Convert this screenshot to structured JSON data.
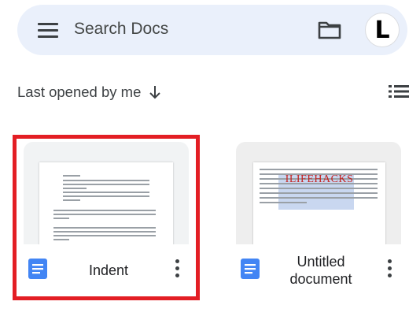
{
  "search": {
    "placeholder": "Search Docs"
  },
  "account": {
    "initial": "L"
  },
  "sort": {
    "label": "Last opened by me"
  },
  "files": [
    {
      "title": "Indent",
      "highlighted": true,
      "highlight_color": "#e31e24"
    },
    {
      "title": "Untitled document",
      "thumbnail_text": "ILIFEHACKS"
    }
  ],
  "icons": {
    "menu": "hamburger-menu-icon",
    "folder": "folder-icon",
    "sort": "arrow-down-icon",
    "view": "list-view-icon",
    "doc": "google-docs-icon",
    "more": "more-vert-icon"
  },
  "colors": {
    "search_bg": "#eaf0fb",
    "docs_blue": "#4285f4",
    "highlight": "#e31e24"
  }
}
